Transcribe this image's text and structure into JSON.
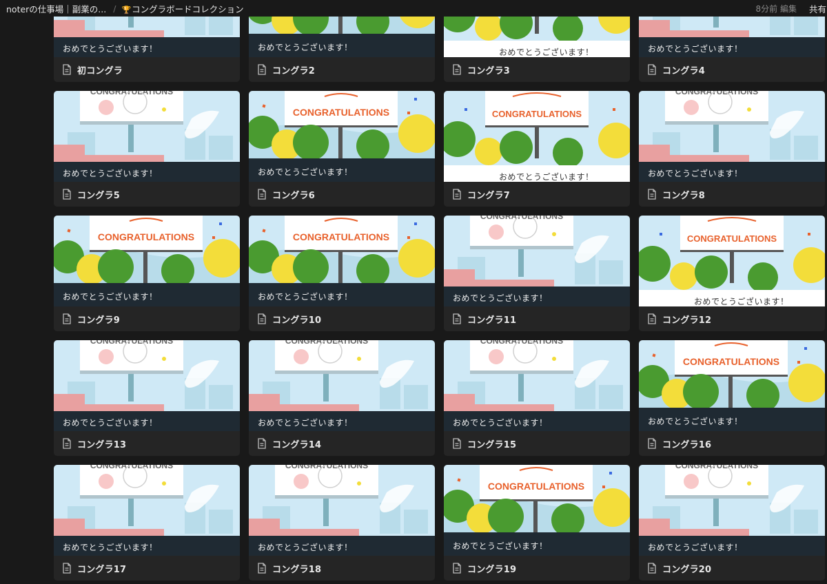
{
  "breadcrumb": {
    "workspace": "noterの仕事場｜副業の...",
    "separator": "/",
    "page_icon": "🏆",
    "page": "コングラボードコレクション"
  },
  "header": {
    "edited": "8分前 編集",
    "share": "共有"
  },
  "cover_message": "おめでとうございます！",
  "cover_banner": "CONGRATULATIONS",
  "cards": [
    {
      "title": "初コングラ",
      "style": "A"
    },
    {
      "title": "コングラ2",
      "style": "B"
    },
    {
      "title": "コングラ3",
      "style": "C"
    },
    {
      "title": "コングラ4",
      "style": "A"
    },
    {
      "title": "コングラ5",
      "style": "A"
    },
    {
      "title": "コングラ6",
      "style": "B"
    },
    {
      "title": "コングラ7",
      "style": "C"
    },
    {
      "title": "コングラ8",
      "style": "A"
    },
    {
      "title": "コングラ9",
      "style": "B"
    },
    {
      "title": "コングラ10",
      "style": "B"
    },
    {
      "title": "コングラ11",
      "style": "A"
    },
    {
      "title": "コングラ12",
      "style": "C"
    },
    {
      "title": "コングラ13",
      "style": "A"
    },
    {
      "title": "コングラ14",
      "style": "A"
    },
    {
      "title": "コングラ15",
      "style": "A"
    },
    {
      "title": "コングラ16",
      "style": "B"
    },
    {
      "title": "コングラ17",
      "style": "A"
    },
    {
      "title": "コングラ18",
      "style": "D"
    },
    {
      "title": "コングラ19",
      "style": "B"
    },
    {
      "title": "コングラ20",
      "style": "D"
    }
  ],
  "colors": {
    "background": "#191919",
    "card": "#252525",
    "sky": "#cfe9f6",
    "tree_green": "#4a9b30",
    "tree_yellow": "#f3dd3a",
    "banner_orange": "#e8612c",
    "ground_dark": "#1f2a33",
    "pink_ledge": "#e8a0a0"
  }
}
